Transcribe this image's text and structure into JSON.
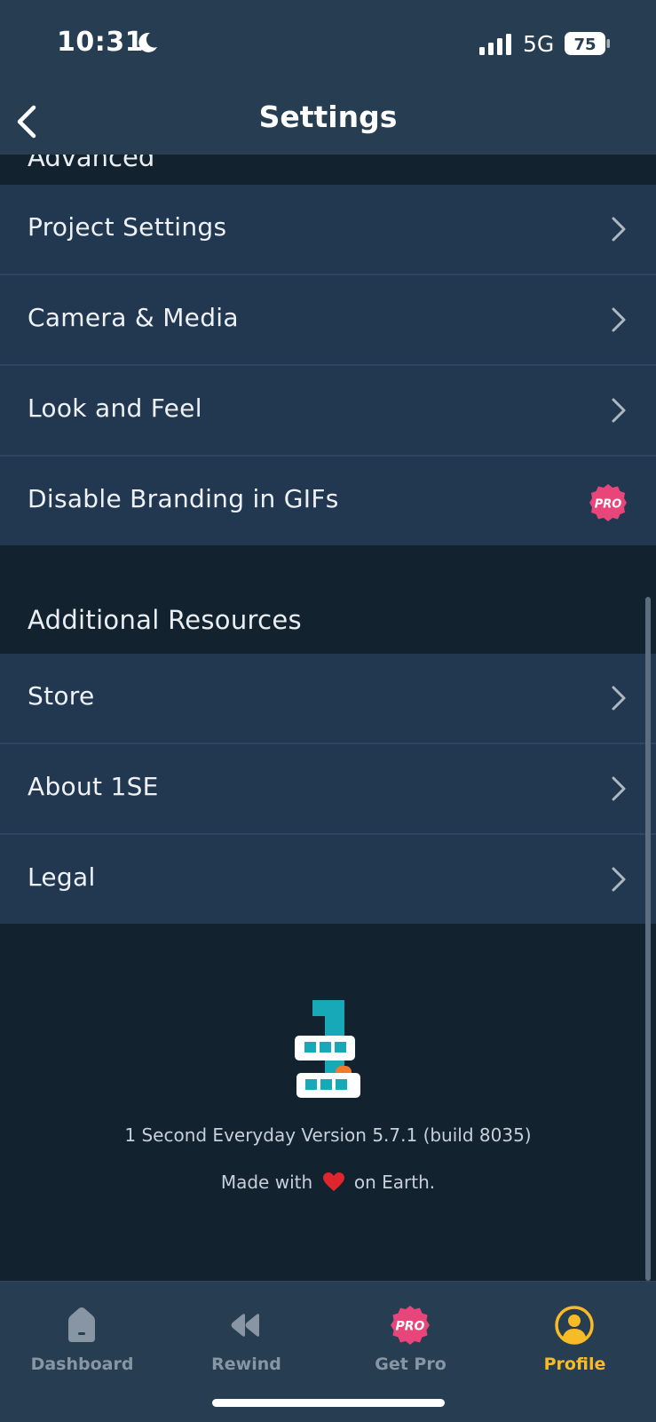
{
  "status_bar": {
    "time": "10:31",
    "network": "5G",
    "battery": "75"
  },
  "header": {
    "title": "Settings",
    "back_icon": "chevron-left-icon"
  },
  "sections": {
    "advanced_title": "Advanced",
    "advanced_items": [
      {
        "label": "Project Settings"
      },
      {
        "label": "Camera & Media"
      },
      {
        "label": "Look and Feel"
      },
      {
        "label": "Disable Branding in GIFs",
        "badge": "PRO"
      }
    ],
    "resources_title": "Additional Resources",
    "resources_items": [
      {
        "label": "Store"
      },
      {
        "label": "About 1SE"
      },
      {
        "label": "Legal"
      }
    ]
  },
  "footer": {
    "version": "1 Second Everyday Version 5.7.1 (build 8035)",
    "made_prefix": "Made with",
    "made_suffix": "on Earth."
  },
  "tab_bar": {
    "tabs": [
      {
        "label": "Dashboard",
        "icon": "house-icon"
      },
      {
        "label": "Rewind",
        "icon": "rewind-icon"
      },
      {
        "label": "Get Pro",
        "icon": "pro-badge-icon",
        "badge": "PRO"
      },
      {
        "label": "Profile",
        "icon": "profile-icon",
        "active": true
      }
    ]
  },
  "colors": {
    "background": "#13222f",
    "row": "#223850",
    "bar": "#263d52",
    "pro_badge": "#e8457a",
    "active_tab": "#f6bb26",
    "logo_teal": "#18a9b8",
    "logo_orange": "#ef7a2b"
  }
}
